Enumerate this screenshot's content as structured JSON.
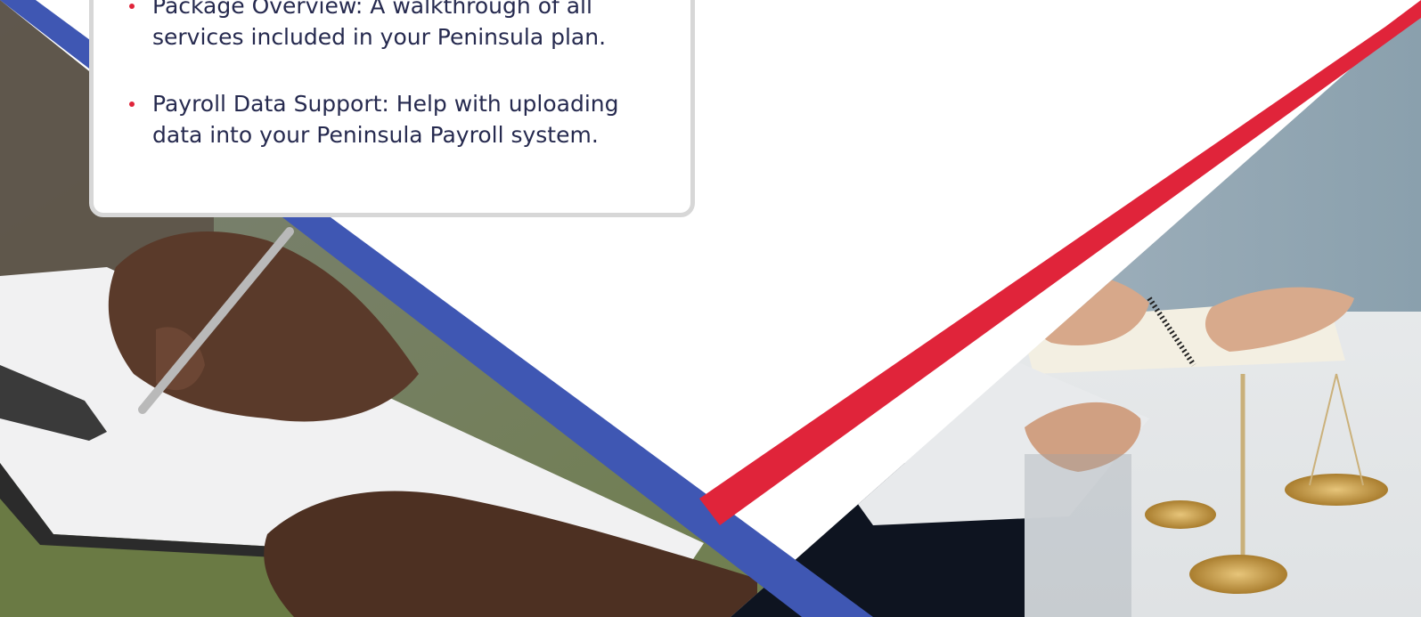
{
  "bullets": [
    {
      "text": "Package Overview: A walkthrough of all services included in your Peninsula plan."
    },
    {
      "text": "Payroll Data Support: Help with uploading data into your Peninsula Payroll system."
    }
  ],
  "colors": {
    "accent_red": "#e0243a",
    "accent_blue": "#3f57b3",
    "text": "#262a4f",
    "card_border": "#d7d7d7"
  },
  "images": {
    "left": "hand-writing-on-clipboard-photo",
    "right": "legal-desk-with-scales-photo"
  }
}
